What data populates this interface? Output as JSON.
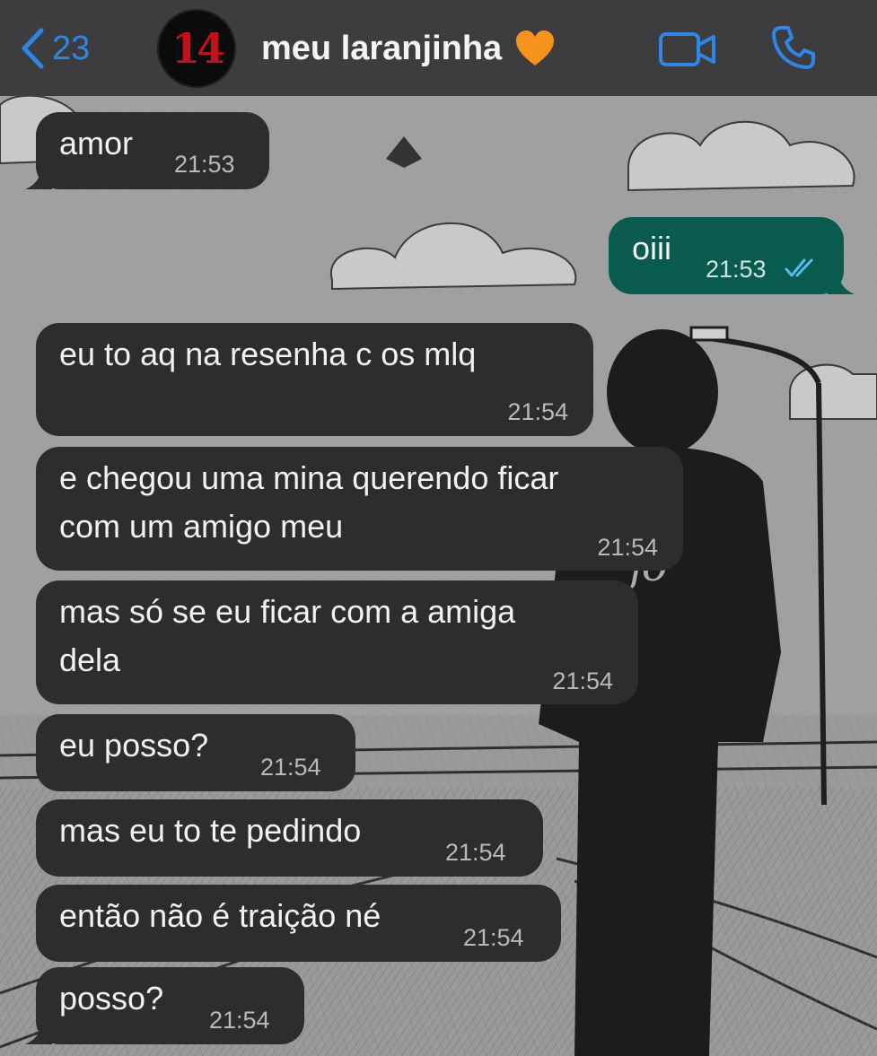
{
  "header": {
    "back_count": "23",
    "avatar_text": "14",
    "contact_name": "meu laranjinha",
    "heart_emoji": "orange-heart",
    "accent_color": "#2f86e6"
  },
  "colors": {
    "incoming_bubble": "#2d2d2f",
    "outgoing_bubble": "#0a5b4f",
    "read_ticks": "#53bdeb"
  },
  "messages": [
    {
      "direction": "in",
      "text": "amor",
      "time": "21:53"
    },
    {
      "direction": "out",
      "text": "oiii",
      "time": "21:53",
      "status": "read"
    },
    {
      "direction": "in",
      "text": "eu to aq na resenha c os mlq",
      "time": "21:54"
    },
    {
      "direction": "in",
      "line1": "e chegou uma mina querendo ficar",
      "line2": "com um amigo meu",
      "time": "21:54"
    },
    {
      "direction": "in",
      "line1": "mas só se eu ficar com a amiga",
      "line2": "dela",
      "time": "21:54"
    },
    {
      "direction": "in",
      "text": "eu posso?",
      "time": "21:54"
    },
    {
      "direction": "in",
      "text": "mas eu to te pedindo",
      "time": "21:54"
    },
    {
      "direction": "in",
      "text": "então não é traição né",
      "time": "21:54"
    },
    {
      "direction": "in",
      "text": "posso?",
      "time": "21:54"
    }
  ]
}
